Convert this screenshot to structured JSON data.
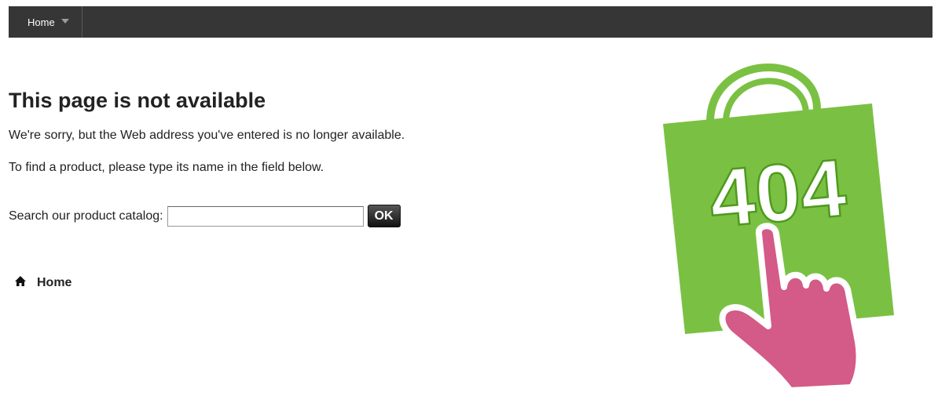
{
  "navbar": {
    "items": [
      {
        "label": "Home",
        "has_dropdown": true,
        "icon": "chevron-down-icon"
      }
    ],
    "background": "#363636"
  },
  "main": {
    "title": "This page is not available",
    "message_1": "We're sorry, but the Web address you've entered is no longer available.",
    "message_2": "To find a product, please type its name in the field below.",
    "search": {
      "label": "Search our product catalog:",
      "value": "",
      "button_label": "OK"
    },
    "home_link": {
      "label": "Home",
      "icon": "home-icon"
    }
  },
  "illustration": {
    "text": "404",
    "bag_color": "#7ac143",
    "hand_color": "#d45a87"
  }
}
